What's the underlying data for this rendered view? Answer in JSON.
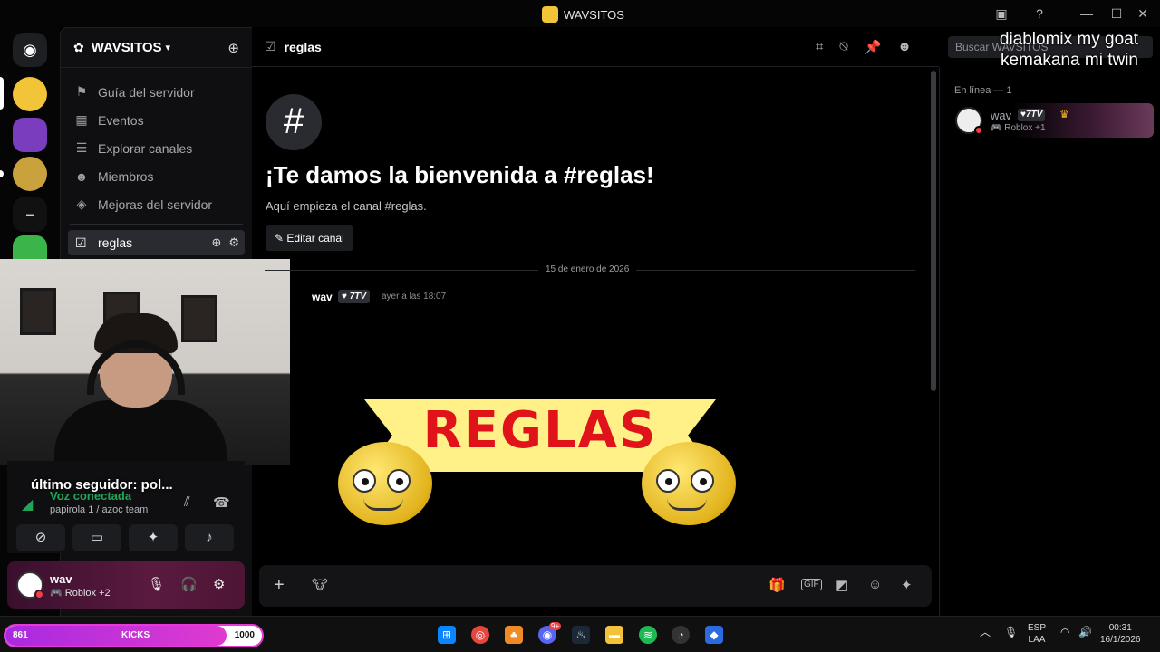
{
  "window": {
    "title": "WAVSITOS",
    "controls": {
      "minimize": "—",
      "maximize": "☐",
      "close": "✕"
    }
  },
  "overlay_text": {
    "line1": "diablomix my goat",
    "line2": "kemakana mi twin"
  },
  "server": {
    "name": "WAVSITOS",
    "nav_items": [
      {
        "label": "Guía del servidor",
        "icon": "signpost-icon"
      },
      {
        "label": "Eventos",
        "icon": "calendar-icon"
      },
      {
        "label": "Explorar canales",
        "icon": "browse-channels-icon"
      },
      {
        "label": "Miembros",
        "icon": "members-icon"
      },
      {
        "label": "Mejoras del servidor",
        "icon": "boost-icon"
      }
    ],
    "active_channel": "reglas"
  },
  "voice": {
    "follower_overlay": "último seguidor: pol...",
    "status": "Voz conectada",
    "room": "papirola 1 / azoc team"
  },
  "user": {
    "name": "wav",
    "status": "Roblox +2"
  },
  "chat": {
    "channel": "reglas",
    "search_placeholder": "Buscar WAVSITOS",
    "welcome_title": "¡Te damos la bienvenida a #reglas!",
    "welcome_sub": "Aquí empieza el canal #reglas.",
    "edit_button": "Editar canal",
    "date_separator": "15 de enero de 2026",
    "message": {
      "author": "wav",
      "badge": "7TV",
      "time": "ayer a las 18:07",
      "image_text": "REGLAS"
    }
  },
  "members": {
    "header": "En línea — 1",
    "list": [
      {
        "name": "wav",
        "badge": "7TV",
        "status": "Roblox +1"
      }
    ]
  },
  "taskbar": {
    "kicks": {
      "current": "861",
      "label": "KICKS",
      "goal": "1000",
      "progress": 0.861
    },
    "lang_top": "ESP",
    "lang_bottom": "LAA",
    "time": "00:31",
    "date": "16/1/2026",
    "discord_badge": "9+"
  },
  "colors": {
    "accent_green": "#23a559",
    "status_red": "#f23f43",
    "banner_yellow": "#fff087",
    "banner_red": "#e0121a",
    "kicks_pink": "#e03ad0"
  }
}
